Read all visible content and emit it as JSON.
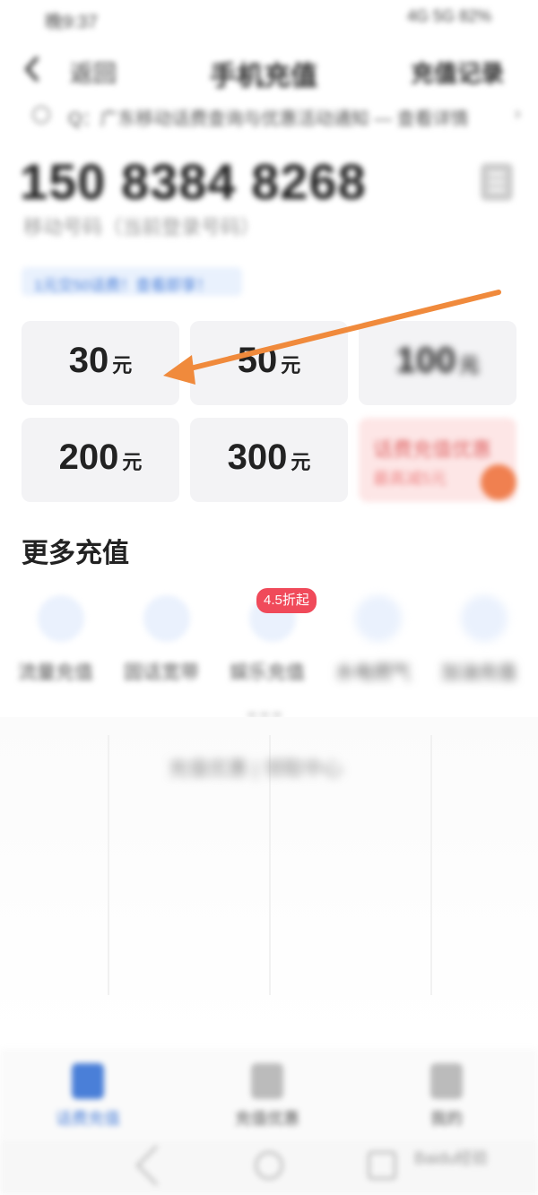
{
  "status_bar": {
    "left": "晚9:37",
    "right": "4G 5G 82%"
  },
  "header": {
    "back_label": "返回",
    "title": "手机充值",
    "records_link": "充值记录"
  },
  "notice": {
    "text": "Q：广东移动话费查询与优惠活动通知 — 查看详情",
    "arrow": "›"
  },
  "phone": {
    "number": "150 8384 8268",
    "sub": "移动号码（当前登录号码）"
  },
  "promo_tag": "1元交50话费！查看即享！",
  "amounts": [
    {
      "value": "30",
      "unit": "元"
    },
    {
      "value": "50",
      "unit": "元"
    },
    {
      "value": "100",
      "unit": "元"
    },
    {
      "value": "200",
      "unit": "元"
    },
    {
      "value": "300",
      "unit": "元"
    }
  ],
  "special_tile": {
    "line1": "话费充值优惠",
    "line2": "最高减5元"
  },
  "more": {
    "title": "更多充值",
    "badge": "4.5折起",
    "services": [
      {
        "label": "流量充值",
        "icon": "data-card-icon"
      },
      {
        "label": "固话宽带",
        "icon": "router-icon"
      },
      {
        "label": "娱乐充值",
        "icon": "gamepad-icon"
      },
      {
        "label": "水电燃气",
        "icon": "water-drop-icon"
      },
      {
        "label": "加油充值",
        "icon": "fuel-icon"
      }
    ]
  },
  "pane_tabs": "充值优惠 | 领取中心",
  "bottom_nav": [
    {
      "label": "话费充值",
      "icon": "home-icon",
      "active": true
    },
    {
      "label": "充值优惠",
      "icon": "coupon-icon",
      "active": false
    },
    {
      "label": "我的",
      "icon": "user-icon",
      "active": false
    }
  ],
  "watermark": "Baidu经验",
  "colors": {
    "accent": "#4a7fd8",
    "arrow": "#f08a3c",
    "badge": "#f04a5a"
  }
}
